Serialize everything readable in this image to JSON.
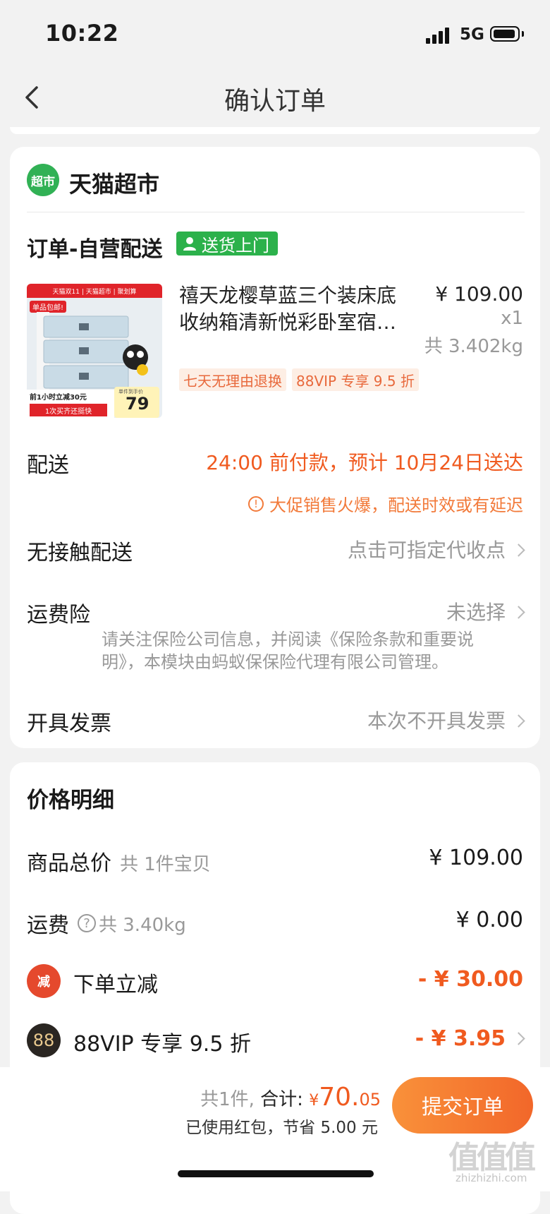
{
  "status_bar": {
    "time": "10:22",
    "network": "5G"
  },
  "nav": {
    "title": "确认订单"
  },
  "shop": {
    "logo_text": "超市",
    "name": "天猫超市"
  },
  "order": {
    "type_label": "订单-自营配送",
    "delivery_tag": "送货上门",
    "product": {
      "title": "禧天龙樱草蓝三个装床底收纳箱清新悦彩卧室宿…",
      "price": "¥ 109.00",
      "quantity": "x1",
      "weight": "共 3.402kg",
      "tags": [
        "七天无理由退换",
        "88VIP 专享 9.5 折"
      ],
      "image_texts": {
        "banner": "天猫双11 | 天猫超市 | 聚划算",
        "free_ship": "单品包邮!",
        "promo1": "前1小时立减30元",
        "promo2": "1次买齐还挺快",
        "price_label": "单件到手价",
        "price_value": "79"
      }
    }
  },
  "rows": {
    "delivery": {
      "label": "配送",
      "value": "24:00 前付款，预计 10月24日送达",
      "warning": "大促销售火爆，配送时效或有延迟"
    },
    "contactless": {
      "label": "无接触配送",
      "value": "点击可指定代收点"
    },
    "shipping_insurance": {
      "label": "运费险",
      "value": "未选择",
      "note": "请关注保险公司信息，并阅读《保险条款和重要说明》，本模块由蚂蚁保保险代理有限公司管理。"
    },
    "invoice": {
      "label": "开具发票",
      "value": "本次不开具发票"
    }
  },
  "price_detail": {
    "title": "价格明细",
    "goods_total": {
      "label": "商品总价",
      "sub": "共 1件宝贝",
      "value": "¥ 109.00"
    },
    "shipping": {
      "label": "运费",
      "sub": "共 3.40kg",
      "value": "¥ 0.00"
    },
    "discount": {
      "icon_text": "减",
      "label": "下单立减",
      "value": "- ¥ 30.00"
    },
    "vip": {
      "icon_text": "88",
      "label": "88VIP 专享 9.5 折",
      "value": "- ¥ 3.95"
    }
  },
  "bottom": {
    "count": "共1件,",
    "total_label": "合计:",
    "currency": "¥",
    "total_int": "70.",
    "total_dec": "05",
    "saved": "已使用红包，节省 5.00 元",
    "submit": "提交订单"
  },
  "watermark": {
    "main": "值值值",
    "sub": "zhizhizhi.com"
  },
  "colors": {
    "accent": "#f05a1f",
    "green": "#2cb14b",
    "tag_bg": "#fdeee4"
  }
}
